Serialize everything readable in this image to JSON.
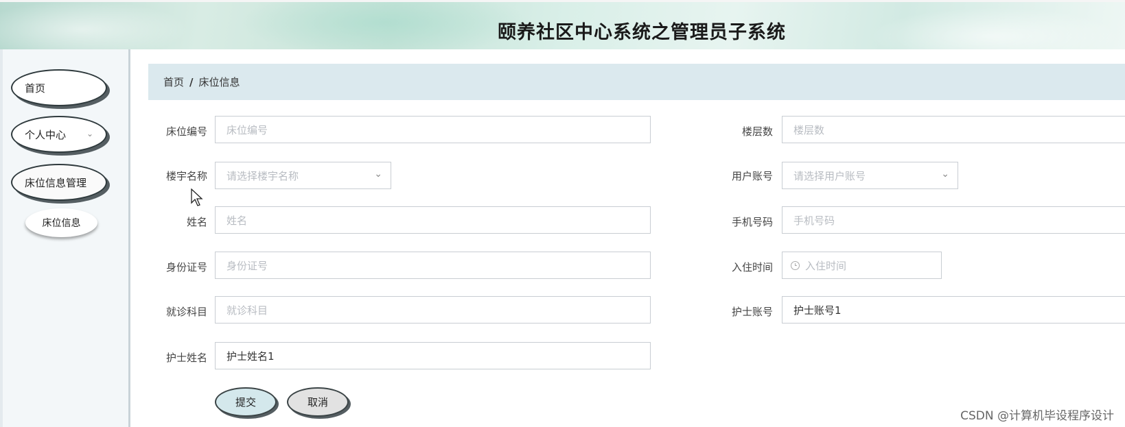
{
  "header": {
    "title": "颐养社区中心系统之管理员子系统"
  },
  "sidebar": {
    "items": [
      {
        "label": "首页"
      },
      {
        "label": "个人中心",
        "chevron": "chevron-down-icon"
      },
      {
        "label": "床位信息管理"
      }
    ],
    "sub_items": [
      {
        "label": "床位信息"
      }
    ]
  },
  "breadcrumb": {
    "home": "首页",
    "separator": "/",
    "current": "床位信息"
  },
  "form": {
    "bed_no": {
      "label": "床位编号",
      "placeholder": "床位编号"
    },
    "floors": {
      "label": "楼层数",
      "placeholder": "楼层数"
    },
    "building": {
      "label": "楼宇名称",
      "placeholder": "请选择楼宇名称"
    },
    "user_account": {
      "label": "用户账号",
      "placeholder": "请选择用户账号"
    },
    "name": {
      "label": "姓名",
      "placeholder": "姓名"
    },
    "phone": {
      "label": "手机号码",
      "placeholder": "手机号码"
    },
    "id_number": {
      "label": "身份证号",
      "placeholder": "身份证号"
    },
    "checkin_time": {
      "label": "入住时间",
      "placeholder": "入住时间"
    },
    "department": {
      "label": "就诊科目",
      "placeholder": "就诊科目"
    },
    "nurse_account": {
      "label": "护士账号",
      "value": "护士账号1"
    },
    "nurse_name": {
      "label": "护士姓名",
      "value": "护士姓名1"
    }
  },
  "buttons": {
    "submit": "提交",
    "cancel": "取消"
  },
  "watermark": "CSDN @计算机毕设程序设计",
  "colors": {
    "breadcrumb_bg": "#dbe9ee",
    "submit_bg": "#d4e8ec",
    "cancel_bg": "#e2e2e2"
  }
}
